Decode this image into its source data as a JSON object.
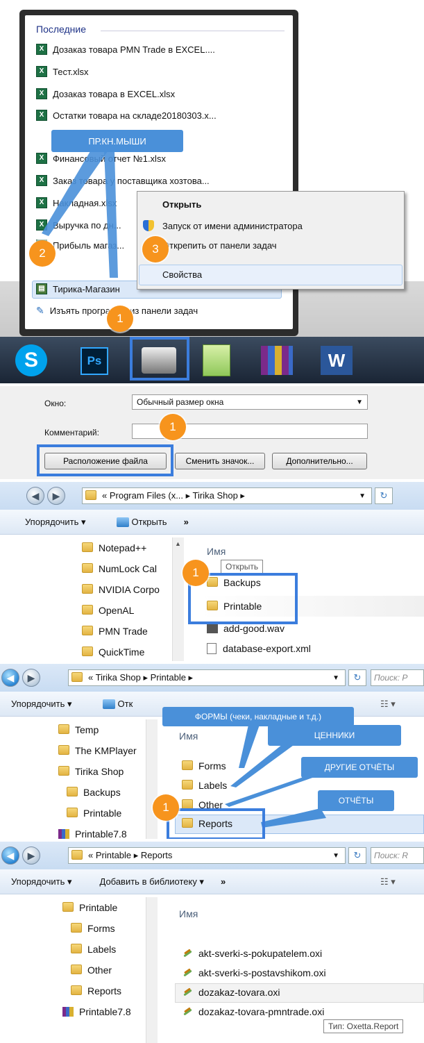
{
  "jumplist": {
    "section_title": "Последние",
    "items": [
      "Дозаказ товара PMN Trade в EXCEL....",
      "Тест.xlsx",
      "Дозаказ товара в EXCEL.xlsx",
      "Остатки товара на складе20180303.x...",
      "Финансовый отчет №1.xlsx",
      "Заказ товара у поставщика хозтова...",
      "Накладная.xlsx",
      "Выручка по дн...",
      "Прибыль магаз..."
    ],
    "pinned_app": "Тирика-Магазин",
    "unpin_task": "Изъять программу из панели задач",
    "callout_right_click": "ПР.КН.МЫШИ"
  },
  "context_menu": {
    "open": "Открыть",
    "run_as_admin": "Запуск от имени администратора",
    "unpin": "Открепить от панели задач",
    "properties": "Свойства"
  },
  "taskbar": {
    "apps": [
      "skype-icon",
      "photoshop-icon",
      "tirika-shop-icon",
      "notepadpp-icon",
      "winrar-icon",
      "word-icon"
    ],
    "skype_label": "S",
    "ps_label": "Ps",
    "word_label": "W"
  },
  "properties": {
    "window_label": "Окно:",
    "window_value": "Обычный размер окна",
    "comment_label": "Комментарий:",
    "btn_file_location": "Расположение файла",
    "btn_change_icon": "Сменить значок...",
    "btn_advanced": "Дополнительно..."
  },
  "explorer1": {
    "address": "« Program Files (x... ▸ Tirika Shop ▸",
    "organize": "Упорядочить ▾",
    "open": "Открыть",
    "more": "»",
    "tree": [
      "Notepad++",
      "NumLock Cal",
      "NVIDIA Corpo",
      "OpenAL",
      "PMN Trade",
      "QuickTime"
    ],
    "col_name": "Имя",
    "tooltip": "Открыть",
    "files": [
      "Backups",
      "Printable",
      "add-good.wav",
      "database-export.xml"
    ]
  },
  "explorer2": {
    "address": "« Tirika Shop ▸ Printable ▸",
    "search_placeholder": "Поиск: P",
    "organize": "Упорядочить ▾",
    "open": "Отк",
    "tree": [
      "Temp",
      "The KMPlayer",
      "Tirika Shop",
      "Backups",
      "Printable",
      "Printable7.8"
    ],
    "col_name": "Имя",
    "files": [
      "Forms",
      "Labels",
      "Other",
      "Reports"
    ],
    "callout_forms": "ФОРМЫ (чеки, накладные и т.д.)",
    "callout_labels": "ЦЕННИКИ",
    "callout_other": "ДРУГИЕ ОТЧЁТЫ",
    "callout_reports": "ОТЧЁТЫ"
  },
  "explorer3": {
    "address": "« Printable ▸ Reports",
    "search_placeholder": "Поиск: R",
    "organize": "Упорядочить ▾",
    "add_library": "Добавить в библиотеку ▾",
    "more": "»",
    "tree": [
      "Printable",
      "Forms",
      "Labels",
      "Other",
      "Reports",
      "Printable7.8"
    ],
    "col_name": "Имя",
    "files": [
      "akt-sverki-s-pokupatelem.oxi",
      "akt-sverki-s-postavshikom.oxi",
      "dozakaz-tovara.oxi",
      "dozakaz-tovara-pmntrade.oxi"
    ],
    "tooltip": "Тип: Oxetta.Report"
  },
  "badges": {
    "one": "1",
    "two": "2",
    "three": "3"
  }
}
